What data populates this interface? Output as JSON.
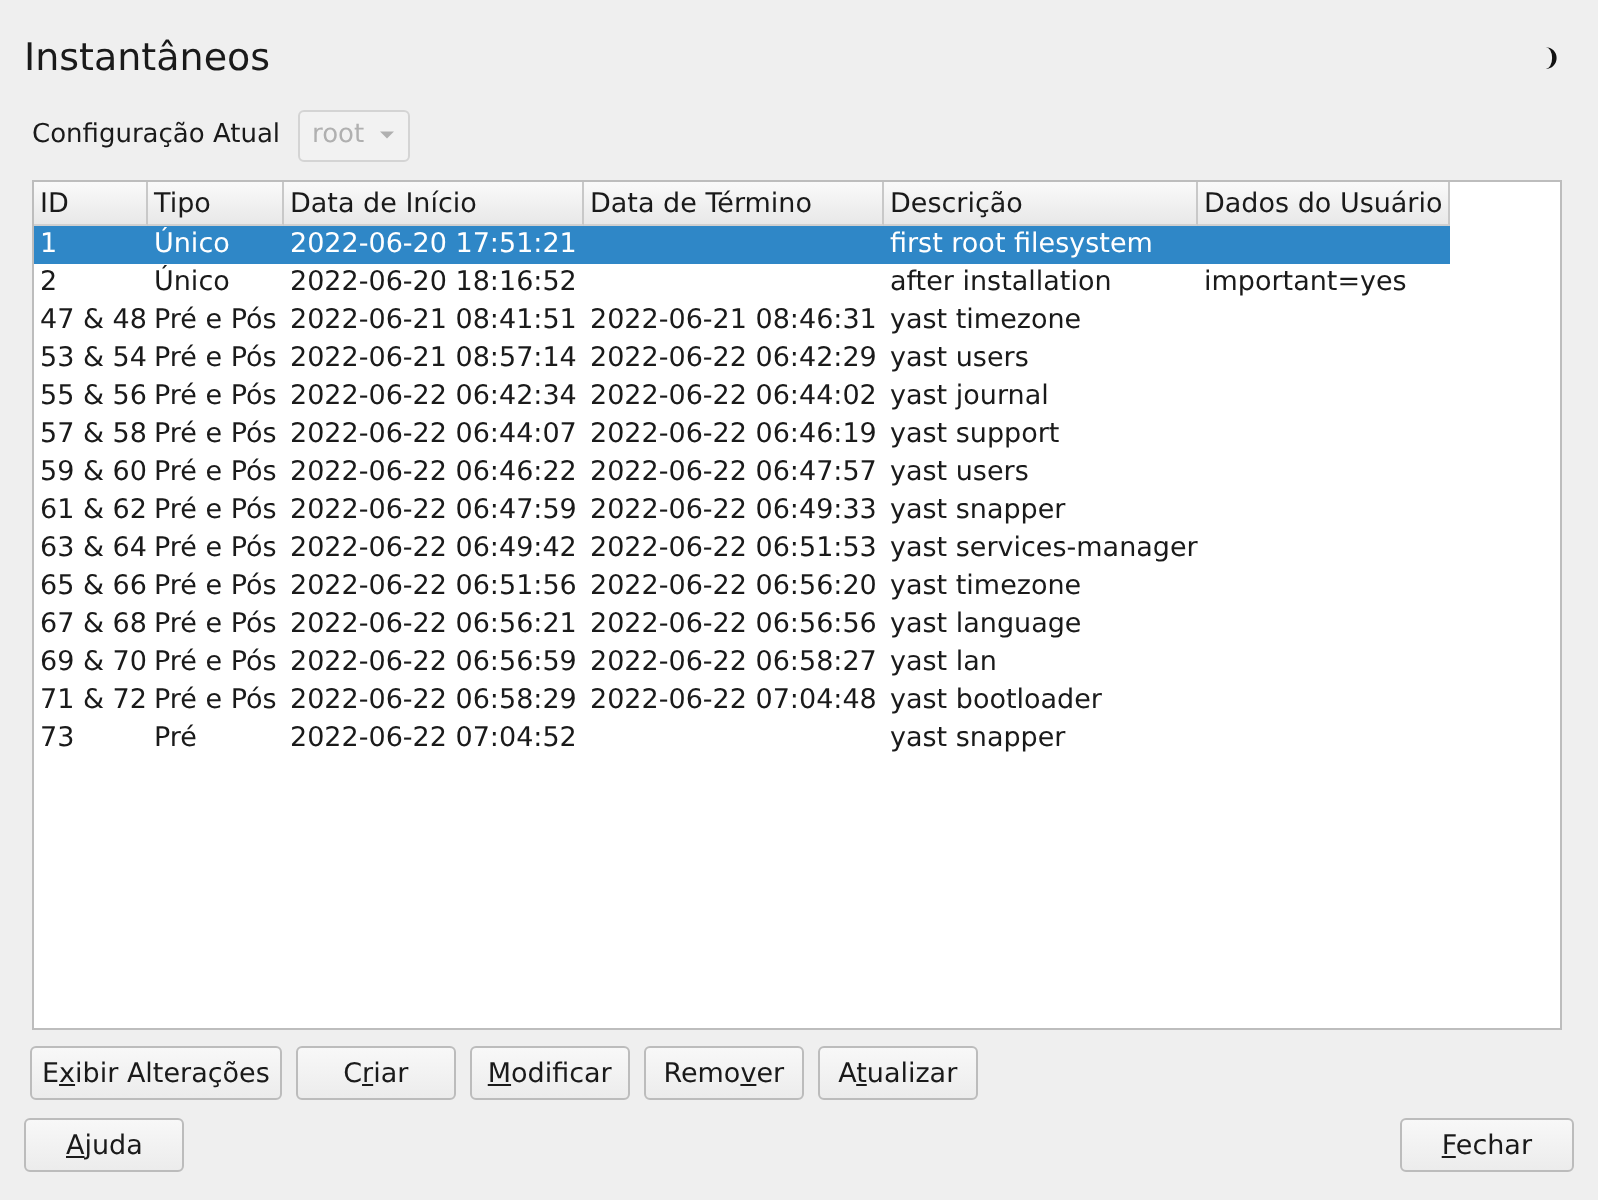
{
  "window": {
    "title": "Instantâneos"
  },
  "config": {
    "label": "Configuração Atual",
    "value": "root",
    "disabled": true
  },
  "table": {
    "columns": [
      "ID",
      "Tipo",
      "Data de Início",
      "Data de Término",
      "Descrição",
      "Dados do Usuário"
    ],
    "rows": [
      {
        "cells": [
          "1",
          "Único",
          "2022-06-20 17:51:21",
          "",
          "first root filesystem",
          ""
        ],
        "selected": true
      },
      {
        "cells": [
          "2",
          "Único",
          "2022-06-20 18:16:52",
          "",
          "after installation",
          "important=yes"
        ],
        "selected": false
      },
      {
        "cells": [
          "47 & 48",
          "Pré e Pós",
          "2022-06-21 08:41:51",
          "2022-06-21 08:46:31",
          "yast timezone",
          ""
        ],
        "selected": false
      },
      {
        "cells": [
          "53 & 54",
          "Pré e Pós",
          "2022-06-21 08:57:14",
          "2022-06-22 06:42:29",
          "yast users",
          ""
        ],
        "selected": false
      },
      {
        "cells": [
          "55 & 56",
          "Pré e Pós",
          "2022-06-22 06:42:34",
          "2022-06-22 06:44:02",
          "yast journal",
          ""
        ],
        "selected": false
      },
      {
        "cells": [
          "57 & 58",
          "Pré e Pós",
          "2022-06-22 06:44:07",
          "2022-06-22 06:46:19",
          "yast support",
          ""
        ],
        "selected": false
      },
      {
        "cells": [
          "59 & 60",
          "Pré e Pós",
          "2022-06-22 06:46:22",
          "2022-06-22 06:47:57",
          "yast users",
          ""
        ],
        "selected": false
      },
      {
        "cells": [
          "61 & 62",
          "Pré e Pós",
          "2022-06-22 06:47:59",
          "2022-06-22 06:49:33",
          "yast snapper",
          ""
        ],
        "selected": false
      },
      {
        "cells": [
          "63 & 64",
          "Pré e Pós",
          "2022-06-22 06:49:42",
          "2022-06-22 06:51:53",
          "yast services-manager",
          ""
        ],
        "selected": false
      },
      {
        "cells": [
          "65 & 66",
          "Pré e Pós",
          "2022-06-22 06:51:56",
          "2022-06-22 06:56:20",
          "yast timezone",
          ""
        ],
        "selected": false
      },
      {
        "cells": [
          "67 & 68",
          "Pré e Pós",
          "2022-06-22 06:56:21",
          "2022-06-22 06:56:56",
          "yast language",
          ""
        ],
        "selected": false
      },
      {
        "cells": [
          "69 & 70",
          "Pré e Pós",
          "2022-06-22 06:56:59",
          "2022-06-22 06:58:27",
          "yast lan",
          ""
        ],
        "selected": false
      },
      {
        "cells": [
          "71 & 72",
          "Pré e Pós",
          "2022-06-22 06:58:29",
          "2022-06-22 07:04:48",
          "yast bootloader",
          ""
        ],
        "selected": false
      },
      {
        "cells": [
          "73",
          "Pré",
          "2022-06-22 07:04:52",
          "",
          "yast snapper",
          ""
        ],
        "selected": false
      }
    ]
  },
  "actions": [
    {
      "pre": "E",
      "key": "x",
      "post": "ibir Alterações"
    },
    {
      "pre": "C",
      "key": "r",
      "post": "iar"
    },
    {
      "key": "M",
      "post": "odificar"
    },
    {
      "pre": "Remo",
      "key": "v",
      "post": "er"
    },
    {
      "pre": "A",
      "key": "t",
      "post": "ualizar"
    }
  ],
  "footer": {
    "help": {
      "key": "A",
      "post": "juda"
    },
    "close": {
      "key": "F",
      "post": "echar"
    }
  }
}
